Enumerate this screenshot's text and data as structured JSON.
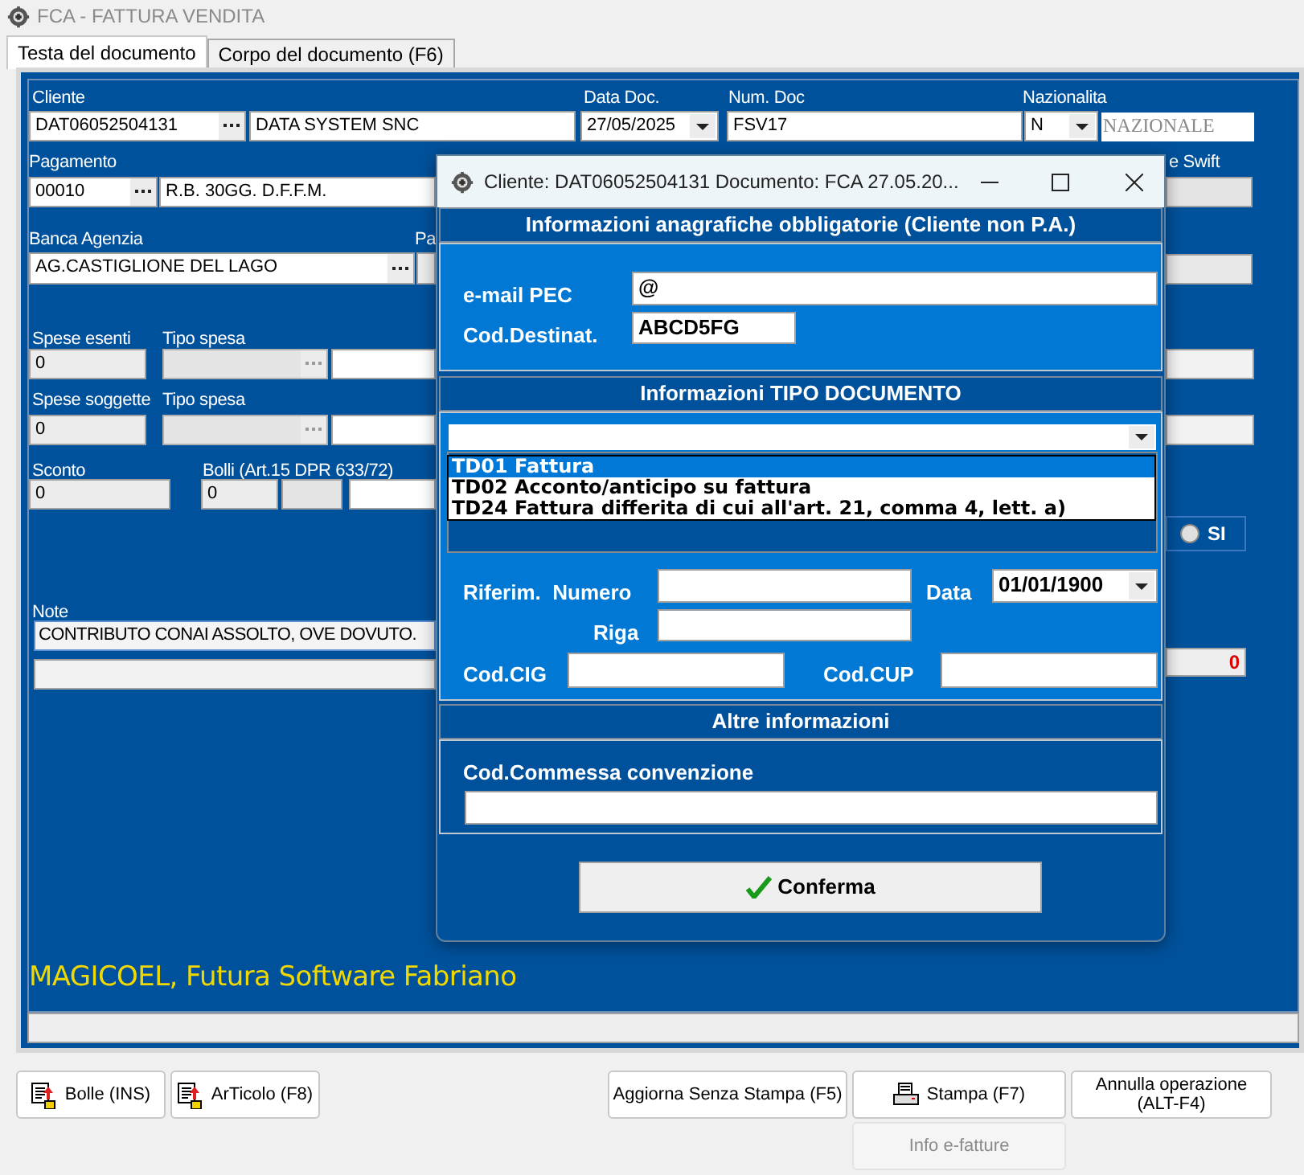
{
  "window": {
    "title": "FCA - FATTURA VENDITA"
  },
  "tabs": [
    {
      "label": "Testa del documento",
      "selected": true
    },
    {
      "label": "Corpo del documento (F6)",
      "selected": false
    }
  ],
  "form": {
    "cliente": {
      "label": "Cliente",
      "code": "DAT06052504131",
      "name": "DATA SYSTEM SNC"
    },
    "data_doc": {
      "label": "Data Doc.",
      "value": "27/05/2025"
    },
    "num_doc": {
      "label": "Num. Doc",
      "value": "FSV17"
    },
    "nazionalita": {
      "label": "Nazionalita",
      "code": "N",
      "value": "NAZIONALE"
    },
    "pagamento": {
      "label": "Pagamento",
      "code": "00010",
      "description": "R.B. 30GG. D.F.F.M."
    },
    "swift_label": "e Swift",
    "banca": {
      "label": "Banca Agenzia",
      "value": "AG.CASTIGLIONE DEL LAGO"
    },
    "partial_label": "Pa",
    "spese_esenti": {
      "label": "Spese esenti",
      "value": "0",
      "type_label": "Tipo spesa"
    },
    "spese_soggette": {
      "label": "Spese soggette",
      "value": "0",
      "type_label": "Tipo spesa"
    },
    "sconto": {
      "label": "Sconto",
      "value": "0"
    },
    "bolli": {
      "label": "Bolli (Art.15 DPR 633/72)",
      "value": "0"
    },
    "si_option": {
      "label": "SI",
      "selected": false
    },
    "note": {
      "label": "Note",
      "value": "CONTRIBUTO CONAI ASSOLTO, OVE DOVUTO."
    },
    "total": "0",
    "footer": "MAGICOEL, Futura Software Fabriano"
  },
  "dialog": {
    "title": "Cliente: DAT06052504131 Documento: FCA 27.05.20...",
    "section_1": {
      "title": "Informazioni anagrafiche obbligatorie (Cliente non P.A.)",
      "pec_label": "e-mail PEC",
      "pec_value": "@",
      "dest_label": "Cod.Destinat.",
      "dest_value": "ABCD5FG"
    },
    "section_2": {
      "title": "Informazioni TIPO DOCUMENTO",
      "options": [
        {
          "label": "TD01 Fattura",
          "selected": true
        },
        {
          "label": "TD02 Acconto/anticipo su fattura",
          "selected": false
        },
        {
          "label": "TD24 Fattura differita di cui all'art. 21, comma 4, lett. a)",
          "selected": false
        }
      ],
      "rif_label": "Riferim.  Numero",
      "data_label": "Data",
      "data_value": "01/01/1900",
      "riga_label": "Riga",
      "cig_label": "Cod.CIG",
      "cup_label": "Cod.CUP"
    },
    "section_3": {
      "title": "Altre informazioni",
      "commessa_label": "Cod.Commessa convenzione"
    },
    "confirm": "Conferma"
  },
  "buttons": [
    {
      "label": "Bolle  (INS)",
      "kind": "doc",
      "disabled": false
    },
    {
      "label": "ArTicolo (F8)",
      "kind": "doc",
      "disabled": false
    },
    {
      "label": "Aggiorna Senza Stampa (F5)",
      "kind": "plain",
      "disabled": false
    },
    {
      "label": "Stampa  (F7)",
      "kind": "print",
      "disabled": false
    },
    {
      "label": "Annulla operazione (ALT-F4)",
      "kind": "plain",
      "disabled": false
    },
    {
      "label": "Info e-fatture",
      "kind": "plain",
      "disabled": true
    }
  ]
}
